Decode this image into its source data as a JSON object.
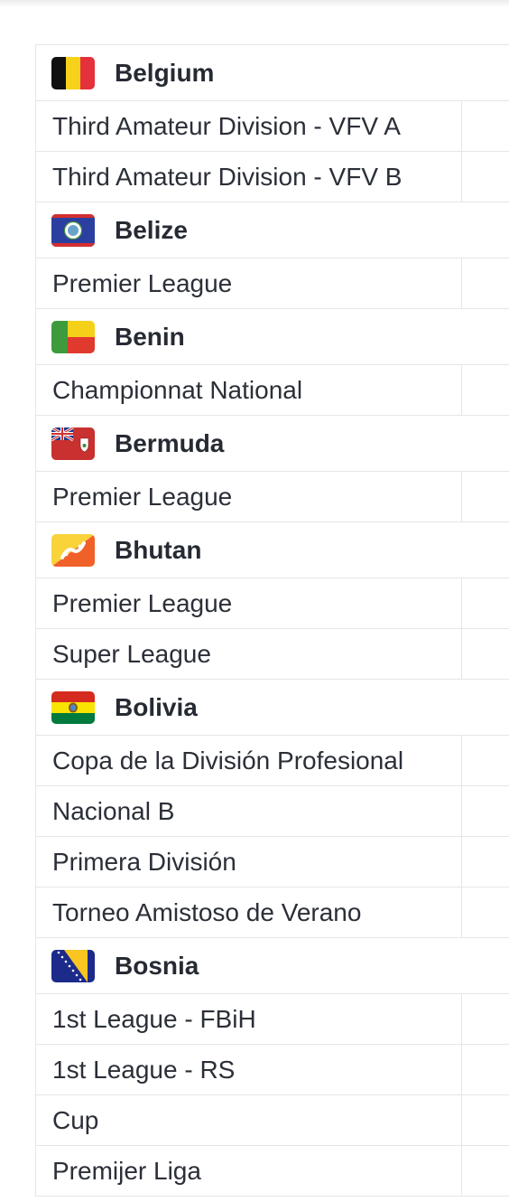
{
  "countries": [
    {
      "name": "Belgium",
      "flag": "belgium-flag",
      "leagues": [
        "Third Amateur Division - VFV A",
        "Third Amateur Division - VFV B"
      ]
    },
    {
      "name": "Belize",
      "flag": "belize-flag",
      "leagues": [
        "Premier League"
      ]
    },
    {
      "name": "Benin",
      "flag": "benin-flag",
      "leagues": [
        "Championnat National"
      ]
    },
    {
      "name": "Bermuda",
      "flag": "bermuda-flag",
      "leagues": [
        "Premier League"
      ]
    },
    {
      "name": "Bhutan",
      "flag": "bhutan-flag",
      "leagues": [
        "Premier League",
        "Super League"
      ]
    },
    {
      "name": "Bolivia",
      "flag": "bolivia-flag",
      "leagues": [
        "Copa de la División Profesional",
        "Nacional B",
        "Primera División",
        "Torneo Amistoso de Verano"
      ]
    },
    {
      "name": "Bosnia",
      "flag": "bosnia-flag",
      "leagues": [
        "1st League - FBiH",
        "1st League - RS",
        "Cup",
        "Premijer Liga"
      ]
    }
  ],
  "colors": {
    "border": "#e4e6e9",
    "text": "#2b2f38"
  }
}
